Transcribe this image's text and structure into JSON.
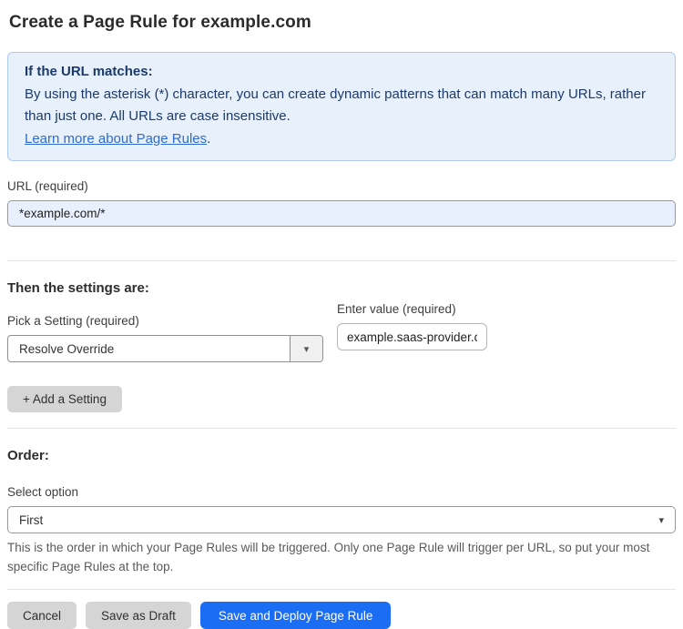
{
  "page": {
    "title": "Create a Page Rule for example.com"
  },
  "info_box": {
    "heading": "If the URL matches:",
    "body": "By using the asterisk (*) character, you can create dynamic patterns that can match many URLs, rather than just one. All URLs are case insensitive.",
    "link_label": "Learn more about Page Rules",
    "link_suffix": "."
  },
  "url_field": {
    "label": "URL (required)",
    "value": "*example.com/*"
  },
  "settings_section": {
    "heading": "Then the settings are:",
    "setting_picker": {
      "label": "Pick a Setting (required)",
      "selected": "Resolve Override",
      "caret_icon": "▾"
    },
    "value_field": {
      "label": "Enter value (required)",
      "value": "example.saas-provider.c"
    },
    "add_setting_label": "+ Add a Setting"
  },
  "order_section": {
    "heading": "Order:",
    "select_label": "Select option",
    "selected": "First",
    "caret_icon": "▾",
    "help_text": "This is the order in which your Page Rules will be triggered. Only one Page Rule will trigger per URL, so put your most specific Page Rules at the top."
  },
  "footer": {
    "cancel_label": "Cancel",
    "save_draft_label": "Save as Draft",
    "save_deploy_label": "Save and Deploy Page Rule"
  },
  "colors": {
    "accent_blue": "#1b6ef3",
    "info_background": "#e8f1fb",
    "info_border": "#aecbf0",
    "info_text": "#1b3a6b",
    "link_blue": "#2e6bd4",
    "url_input_background": "#e8f0fe",
    "gray_button": "#d5d5d5"
  }
}
